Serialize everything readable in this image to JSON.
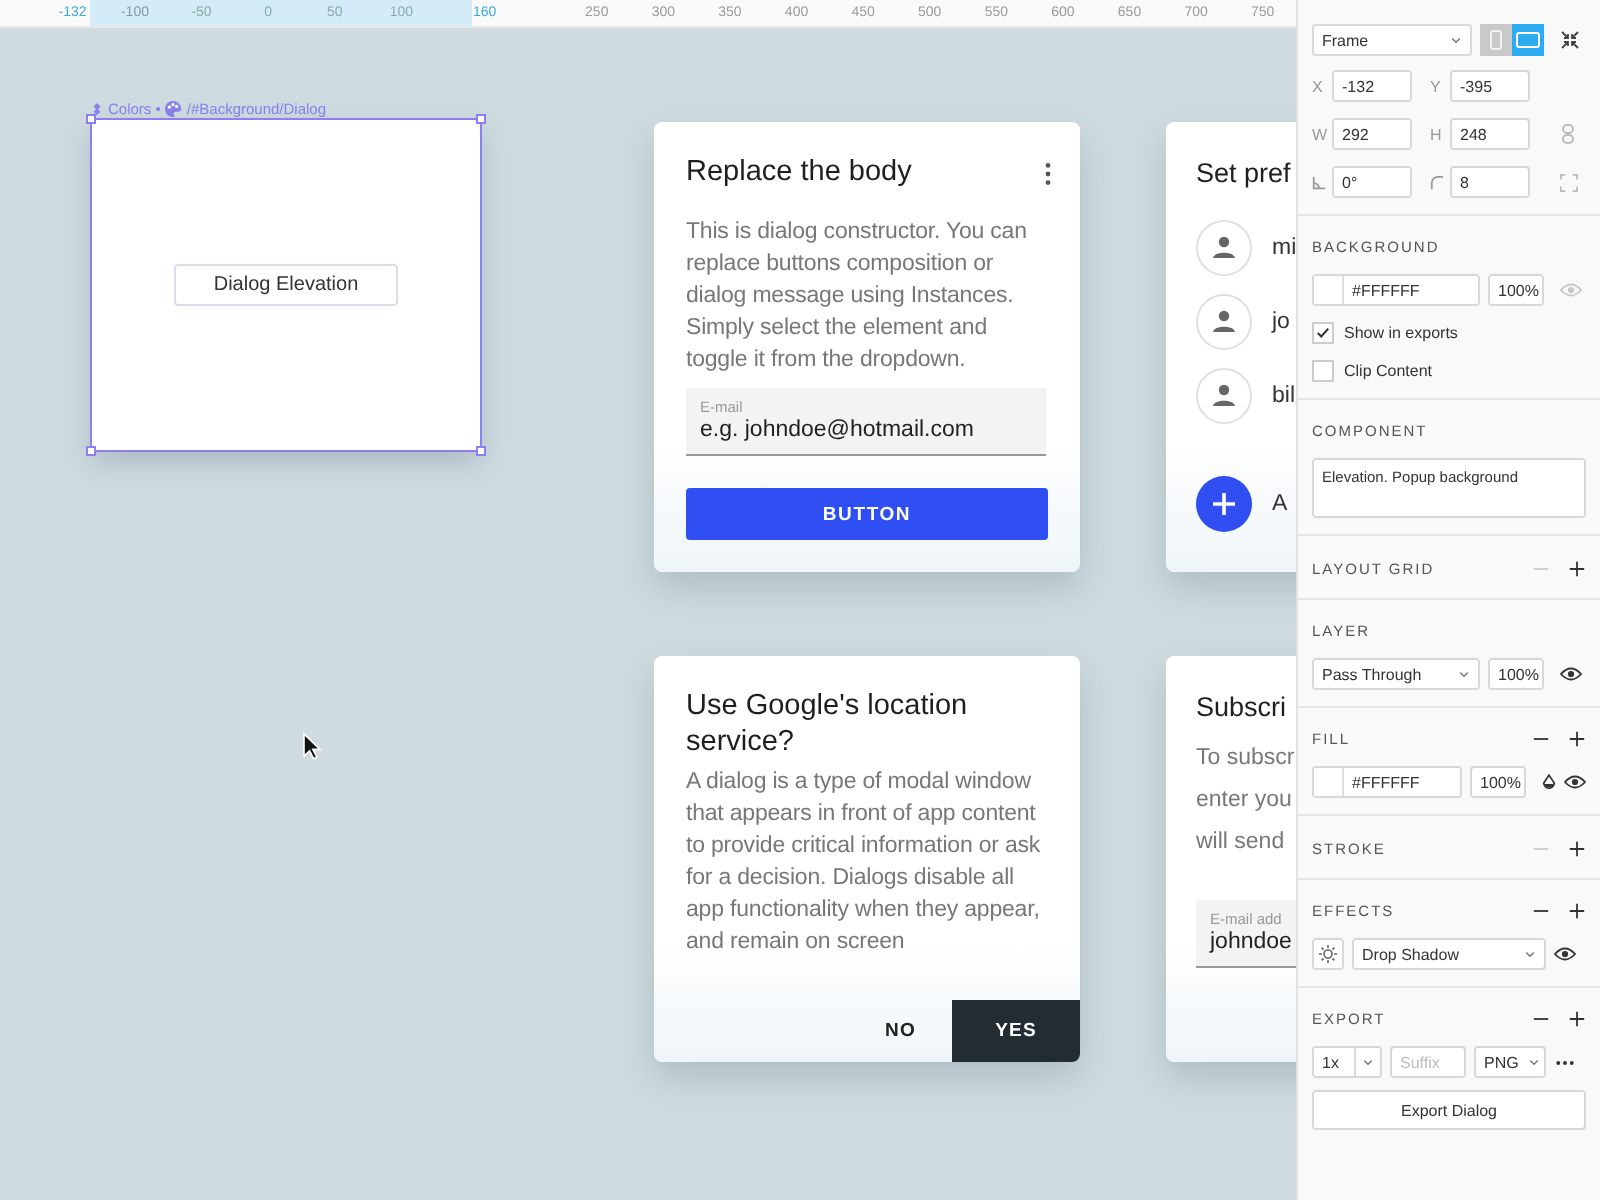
{
  "ruler": {
    "selection_start": "-132",
    "selection_ticks": [
      "-100",
      "-50",
      "0",
      "50",
      "100"
    ],
    "selection_end": "160",
    "ticks": [
      "250",
      "300",
      "350",
      "400",
      "450",
      "500",
      "550",
      "600",
      "650",
      "700",
      "750"
    ]
  },
  "frame": {
    "label_prefix": "Colors •",
    "label_path": "/#Background/Dialog",
    "selected": true,
    "content": "Dialog Elevation"
  },
  "dialogs": [
    {
      "kind": "body",
      "title": "Replace the body",
      "text": "This is dialog constructor. You can replace buttons composition or dialog message using Instances. Simply select the element and toggle it from the dropdown.",
      "field": {
        "label": "E-mail",
        "placeholder": "e.g. johndoe@hotmail.com"
      },
      "buttons": [
        {
          "label": "BUTTON",
          "kind": "primary"
        }
      ]
    },
    {
      "kind": "list",
      "title": "Set pref",
      "items": [
        {
          "label": "mi",
          "kind": "person"
        },
        {
          "label": "jo",
          "kind": "person"
        },
        {
          "label": "bil",
          "kind": "person"
        },
        {
          "label": "A",
          "kind": "add"
        }
      ]
    },
    {
      "kind": "alert",
      "title": "Use Google's location service?",
      "text": "A dialog is a type of modal window that appears in front of app content to provide critical information or ask for a decision. Dialogs disable all app functionality when they appear, and remain on screen",
      "buttons": [
        {
          "label": "NO",
          "kind": "text"
        },
        {
          "label": "YES",
          "kind": "dark"
        }
      ]
    },
    {
      "kind": "form",
      "title": "Subscri",
      "lines": [
        "To subscr",
        "enter you",
        "will send"
      ],
      "field": {
        "label": "E-mail add",
        "value": "johndoe"
      }
    }
  ],
  "panel": {
    "frame_type": "Frame",
    "device_toggles": [
      {
        "kind": "portrait",
        "selected": false
      },
      {
        "kind": "landscape",
        "selected": true
      }
    ],
    "geometry": [
      {
        "kind": "text",
        "label": "X",
        "value": "-132"
      },
      {
        "kind": "text",
        "label": "Y",
        "value": "-395"
      },
      {
        "kind": "text",
        "label": "W",
        "value": "292"
      },
      {
        "kind": "text",
        "label": "H",
        "value": "248"
      },
      {
        "kind": "rotation",
        "value": "0°"
      },
      {
        "kind": "radius",
        "value": "8"
      }
    ],
    "background": {
      "title": "BACKGROUND",
      "hex": "#FFFFFF",
      "opacity": "100%",
      "visible": false,
      "options": [
        {
          "label": "Show in exports",
          "checked": true
        },
        {
          "label": "Clip Content",
          "checked": false
        }
      ]
    },
    "component": {
      "title": "COMPONENT",
      "description": "Elevation. Popup background"
    },
    "layout_grid": {
      "title": "LAYOUT GRID",
      "can_remove": false
    },
    "layer": {
      "title": "LAYER",
      "blend": "Pass Through",
      "opacity": "100%",
      "visible": true
    },
    "fill": {
      "title": "FILL",
      "can_remove": true,
      "hex": "#FFFFFF",
      "opacity": "100%",
      "visible": true
    },
    "stroke": {
      "title": "STROKE",
      "can_remove": false
    },
    "effects": {
      "title": "EFFECTS",
      "can_remove": true,
      "effect": "Drop Shadow",
      "visible": true
    },
    "export": {
      "title": "EXPORT",
      "can_remove": true,
      "scale": "1x",
      "suffix_placeholder": "Suffix",
      "format": "PNG",
      "button": "Export Dialog"
    }
  }
}
